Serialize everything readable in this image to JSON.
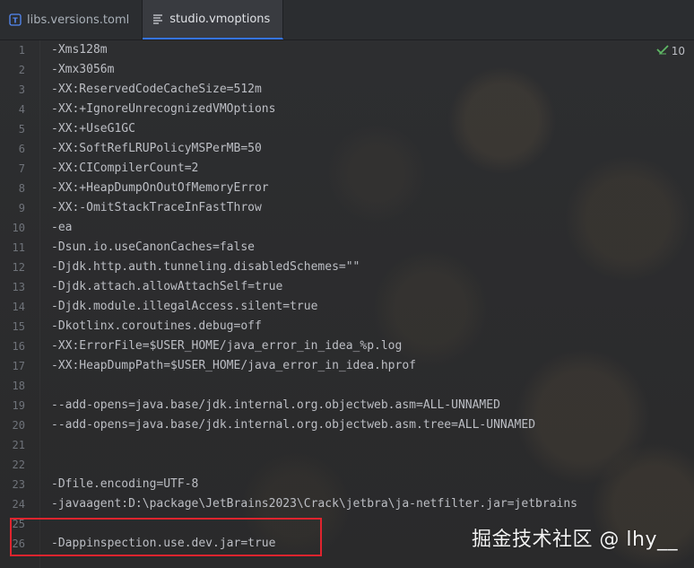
{
  "tabs": [
    {
      "label": "libs.versions.toml",
      "icon": "toml-file-icon",
      "active": false
    },
    {
      "label": "studio.vmoptions",
      "icon": "text-file-icon",
      "active": true
    }
  ],
  "inspection": {
    "count": "10",
    "icon": "check-icon"
  },
  "lines": [
    {
      "n": "1",
      "text": "-Xms128m"
    },
    {
      "n": "2",
      "text": "-Xmx3056m"
    },
    {
      "n": "3",
      "text": "-XX:ReservedCodeCacheSize=512m"
    },
    {
      "n": "4",
      "text": "-XX:+IgnoreUnrecognizedVMOptions"
    },
    {
      "n": "5",
      "text": "-XX:+UseG1GC"
    },
    {
      "n": "6",
      "text": "-XX:SoftRefLRUPolicyMSPerMB=50"
    },
    {
      "n": "7",
      "text": "-XX:CICompilerCount=2"
    },
    {
      "n": "8",
      "text": "-XX:+HeapDumpOnOutOfMemoryError"
    },
    {
      "n": "9",
      "text": "-XX:-OmitStackTraceInFastThrow"
    },
    {
      "n": "10",
      "text": "-ea"
    },
    {
      "n": "11",
      "text": "-Dsun.io.useCanonCaches=false"
    },
    {
      "n": "12",
      "text": "-Djdk.http.auth.tunneling.disabledSchemes=\"\""
    },
    {
      "n": "13",
      "text": "-Djdk.attach.allowAttachSelf=true"
    },
    {
      "n": "14",
      "text": "-Djdk.module.illegalAccess.silent=true"
    },
    {
      "n": "15",
      "text": "-Dkotlinx.coroutines.debug=off"
    },
    {
      "n": "16",
      "text": "-XX:ErrorFile=$USER_HOME/java_error_in_idea_%p.log"
    },
    {
      "n": "17",
      "text": "-XX:HeapDumpPath=$USER_HOME/java_error_in_idea.hprof"
    },
    {
      "n": "18",
      "text": ""
    },
    {
      "n": "19",
      "text": "--add-opens=java.base/jdk.internal.org.objectweb.asm=ALL-UNNAMED"
    },
    {
      "n": "20",
      "text": "--add-opens=java.base/jdk.internal.org.objectweb.asm.tree=ALL-UNNAMED"
    },
    {
      "n": "21",
      "text": ""
    },
    {
      "n": "22",
      "text": ""
    },
    {
      "n": "23",
      "text": "-Dfile.encoding=UTF-8"
    },
    {
      "n": "24",
      "text": "-javaagent:D:\\package\\JetBrains2023\\Crack\\jetbra\\ja-netfilter.jar=jetbrains"
    },
    {
      "n": "25",
      "text": ""
    },
    {
      "n": "26",
      "text": "-Dappinspection.use.dev.jar=true"
    }
  ],
  "watermark": "掘金技术社区 @ lhy__",
  "colors": {
    "accent": "#3574f0",
    "highlight_box": "#e0242e",
    "inspection_check": "#5fb865"
  }
}
